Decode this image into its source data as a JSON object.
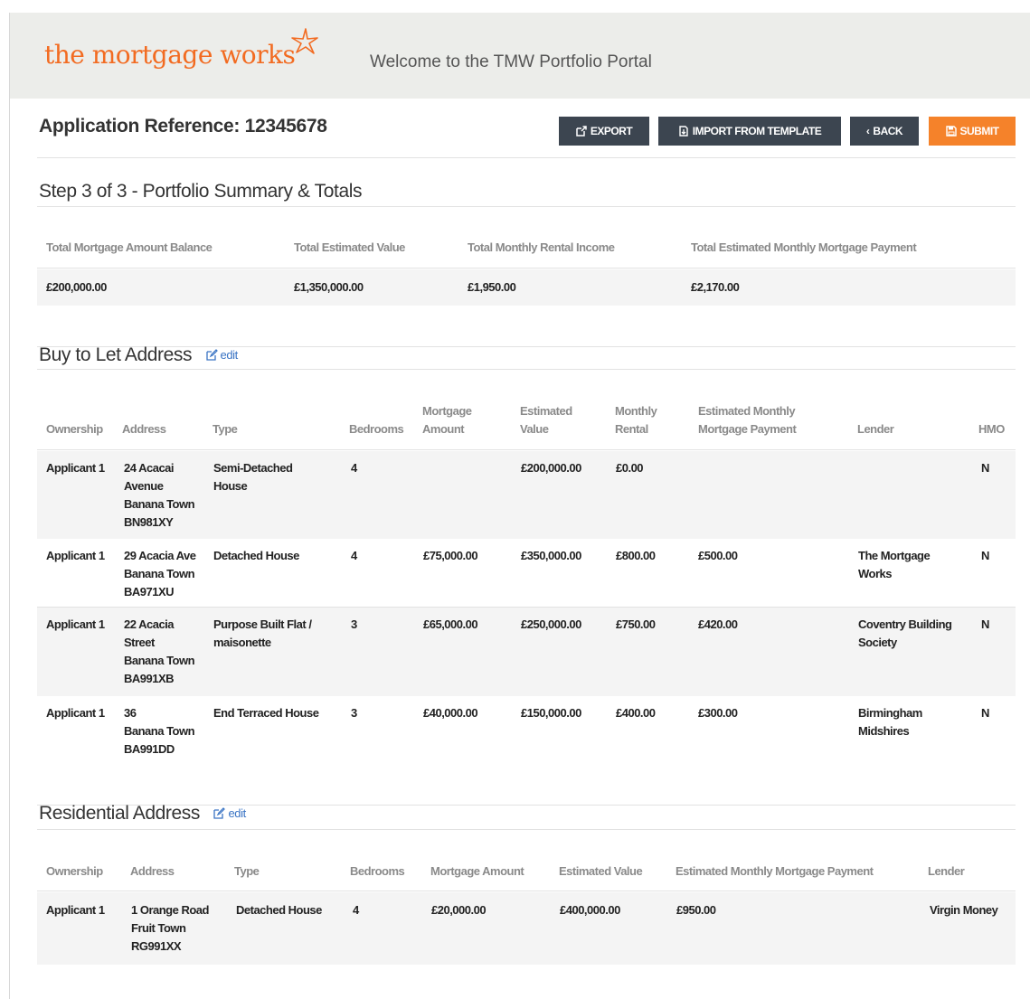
{
  "header": {
    "logo_text": "the mortgage works",
    "welcome": "Welcome to the TMW Portfolio Portal"
  },
  "application": {
    "reference_label": "Application Reference: 12345678"
  },
  "toolbar": {
    "export": "EXPORT",
    "import": "IMPORT FROM TEMPLATE",
    "back": "BACK",
    "submit": "SUBMIT"
  },
  "step": {
    "title": "Step 3 of 3 - Portfolio Summary & Totals"
  },
  "totals": {
    "headers": [
      "Total Mortgage Amount Balance",
      "Total Estimated Value",
      "Total Monthly Rental Income",
      "Total Estimated Monthly Mortgage Payment"
    ],
    "values": [
      "£200,000.00",
      "£1,350,000.00",
      "£1,950.00",
      "£2,170.00"
    ]
  },
  "btl": {
    "title": "Buy to Let Address",
    "edit": "edit",
    "headers": {
      "ownership": "Ownership",
      "address": "Address",
      "type": "Type",
      "bedrooms": "Bedrooms",
      "mortgage_amount_1": "Mortgage",
      "mortgage_amount_2": "Amount",
      "estimated_value_1": "Estimated",
      "estimated_value_2": "Value",
      "monthly_rental_1": "Monthly",
      "monthly_rental_2": "Rental",
      "emmp_1": "Estimated Monthly",
      "emmp_2": "Mortgage Payment",
      "lender": "Lender",
      "hmo": "HMO"
    },
    "rows": [
      {
        "ownership": "Applicant 1",
        "address": [
          "24 Acacai",
          "Avenue",
          "Banana Town",
          "BN981XY"
        ],
        "type": [
          "Semi-Detached",
          "House"
        ],
        "bedrooms": "4",
        "mortgage_amount": "",
        "estimated_value": "£200,000.00",
        "monthly_rental": "£0.00",
        "emmp": "",
        "lender": [],
        "hmo": "N"
      },
      {
        "ownership": "Applicant 1",
        "address": [
          "29 Acacia Ave",
          "Banana Town",
          "BA971XU"
        ],
        "type": [
          "Detached House"
        ],
        "bedrooms": "4",
        "mortgage_amount": "£75,000.00",
        "estimated_value": "£350,000.00",
        "monthly_rental": "£800.00",
        "emmp": "£500.00",
        "lender": [
          "The Mortgage",
          "Works"
        ],
        "hmo": "N"
      },
      {
        "ownership": "Applicant 1",
        "address": [
          "22 Acacia",
          "Street",
          "Banana Town",
          "BA991XB"
        ],
        "type": [
          "Purpose Built Flat /",
          "maisonette"
        ],
        "bedrooms": "3",
        "mortgage_amount": "£65,000.00",
        "estimated_value": "£250,000.00",
        "monthly_rental": "£750.00",
        "emmp": "£420.00",
        "lender": [
          "Coventry Building",
          "Society"
        ],
        "hmo": "N"
      },
      {
        "ownership": "Applicant 1",
        "address": [
          "36",
          "Banana Town",
          "BA991DD"
        ],
        "type": [
          "End Terraced House"
        ],
        "bedrooms": "3",
        "mortgage_amount": "£40,000.00",
        "estimated_value": "£150,000.00",
        "monthly_rental": "£400.00",
        "emmp": "£300.00",
        "lender": [
          "Birmingham",
          "Midshires"
        ],
        "hmo": "N"
      }
    ]
  },
  "residential": {
    "title": "Residential Address",
    "edit": "edit",
    "headers": [
      "Ownership",
      "Address",
      "Type",
      "Bedrooms",
      "Mortgage Amount",
      "Estimated Value",
      "Estimated Monthly Mortgage Payment",
      "Lender"
    ],
    "row": {
      "ownership": "Applicant 1",
      "address": [
        "1 Orange Road",
        "Fruit Town",
        "RG991XX"
      ],
      "type": "Detached House",
      "bedrooms": "4",
      "mortgage_amount": "£20,000.00",
      "estimated_value": "£400,000.00",
      "emmp": "£950.00",
      "lender": "Virgin Money"
    }
  },
  "colors": {
    "brand_orange": "#f26b21",
    "button_dark": "#3c4550",
    "button_orange": "#f5822a",
    "edit_blue": "#3a74c4"
  }
}
